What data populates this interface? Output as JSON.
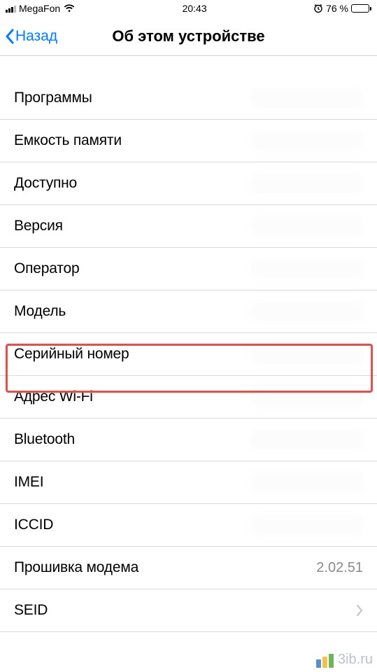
{
  "status": {
    "carrier": "MegaFon",
    "time": "20:43",
    "battery": "76 %"
  },
  "nav": {
    "back": "Назад",
    "title": "Об этом устройстве"
  },
  "rows": {
    "apps": "Программы",
    "capacity": "Емкость памяти",
    "available": "Доступно",
    "version": "Версия",
    "carrier": "Оператор",
    "model": "Модель",
    "serial": "Серийный номер",
    "wifi": "Адрес Wi-Fi",
    "bluetooth": "Bluetooth",
    "imei": "IMEI",
    "iccid": "ICCID",
    "modem": "Прошивка модема",
    "modem_value": "2.02.51",
    "seid": "SEID"
  },
  "watermark": "3ib.ru"
}
